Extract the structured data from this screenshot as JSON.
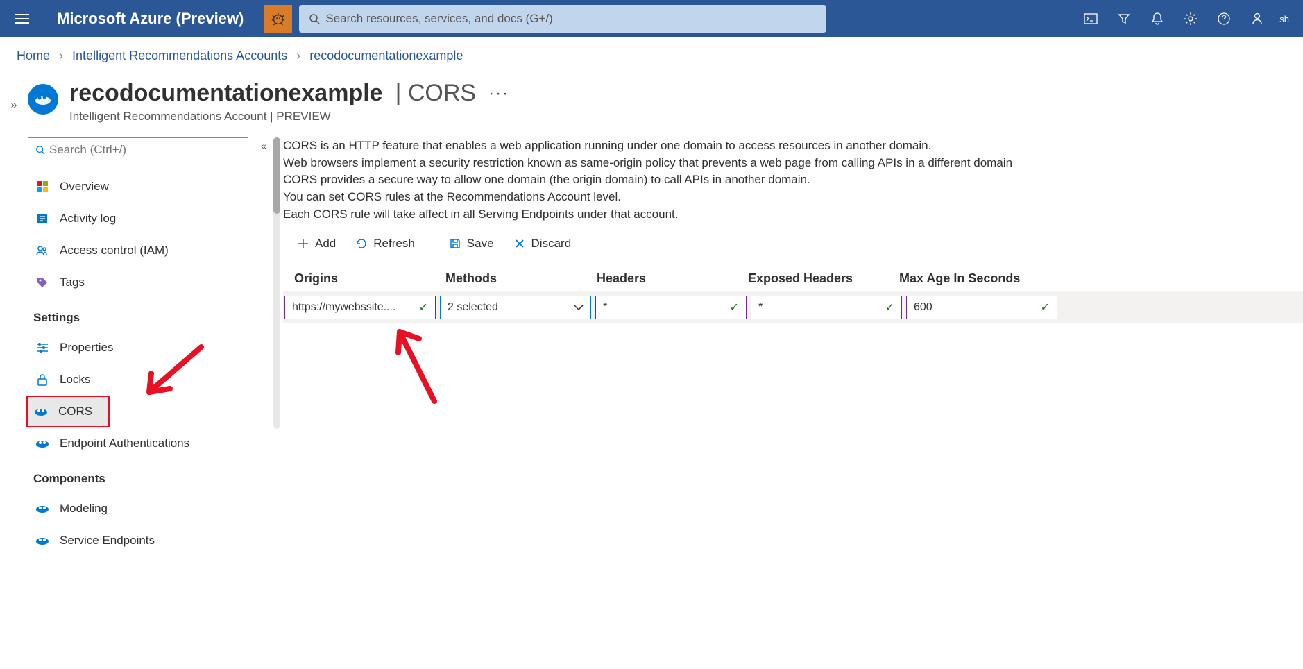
{
  "brand": "Microsoft Azure (Preview)",
  "search": {
    "placeholder": "Search resources, services, and docs (G+/)"
  },
  "user_label": "sh",
  "breadcrumb": {
    "items": [
      "Home",
      "Intelligent Recommendations Accounts",
      "recodocumentationexample"
    ]
  },
  "page": {
    "title": "recodocumentationexample",
    "title_suffix": "| CORS",
    "subtitle": "Intelligent Recommendations Account | PREVIEW"
  },
  "sidebar": {
    "search_placeholder": "Search (Ctrl+/)",
    "groups": [
      {
        "type": "items",
        "items": [
          {
            "id": "overview",
            "label": "Overview"
          },
          {
            "id": "activity-log",
            "label": "Activity log"
          },
          {
            "id": "access-control",
            "label": "Access control (IAM)"
          },
          {
            "id": "tags",
            "label": "Tags"
          }
        ]
      },
      {
        "type": "section",
        "label": "Settings"
      },
      {
        "type": "items",
        "items": [
          {
            "id": "properties",
            "label": "Properties"
          },
          {
            "id": "locks",
            "label": "Locks"
          },
          {
            "id": "cors",
            "label": "CORS",
            "active": true,
            "highlighted": true
          },
          {
            "id": "endpoint-auth",
            "label": "Endpoint Authentications"
          }
        ]
      },
      {
        "type": "section",
        "label": "Components"
      },
      {
        "type": "items",
        "items": [
          {
            "id": "modeling",
            "label": "Modeling"
          },
          {
            "id": "service-endpoints",
            "label": "Service Endpoints"
          }
        ]
      }
    ]
  },
  "info": {
    "line1": "CORS is an HTTP feature that enables a web application running under one domain to access resources in another domain.",
    "line2": "Web browsers implement a security restriction known as same-origin policy that prevents a web page from calling APIs in a different domain",
    "line3": "CORS provides a secure way to allow one domain (the origin domain) to call APIs in another domain.",
    "line4": "You can set CORS rules at the Recommendations Account level.",
    "line5": "Each CORS rule will take affect in all Serving Endpoints under that account."
  },
  "toolbar": {
    "add": "Add",
    "refresh": "Refresh",
    "save": "Save",
    "discard": "Discard"
  },
  "cors_table": {
    "headers": {
      "origins": "Origins",
      "methods": "Methods",
      "headers": "Headers",
      "exposed": "Exposed Headers",
      "maxage": "Max Age In Seconds"
    },
    "row": {
      "origins": "https://mywebssite....",
      "methods": "2 selected",
      "headers": "*",
      "exposed": "*",
      "maxage": "600"
    }
  }
}
